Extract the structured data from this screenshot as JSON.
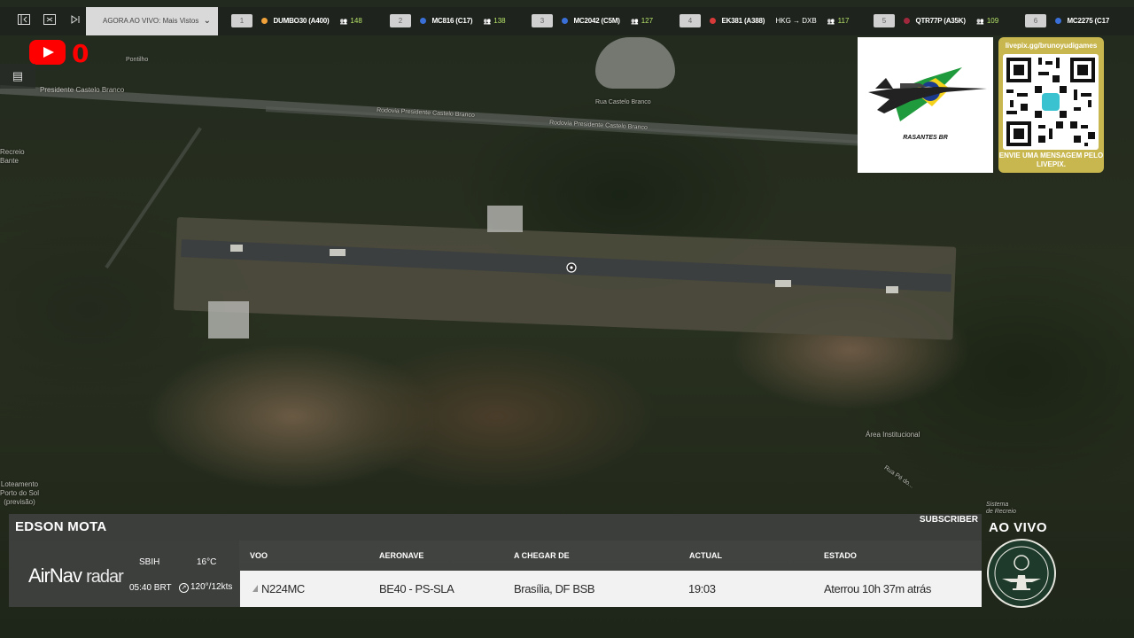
{
  "topbar": {
    "live_select": "AGORA AO VIVO: Mais Vistos",
    "flights": [
      {
        "num": "1",
        "callsign": "DUMBO30 (A400)",
        "count": "148",
        "dot": "#f2a23a"
      },
      {
        "num": "2",
        "callsign": "MC816 (C17)",
        "count": "138",
        "dot": "#3a6fd8"
      },
      {
        "num": "3",
        "callsign": "MC2042 (C5M)",
        "count": "127",
        "dot": "#3a6fd8"
      },
      {
        "num": "4",
        "callsign": "EK381 (A388)",
        "route": "HKG → DXB",
        "count": "117",
        "dot": "#d83a3a"
      },
      {
        "num": "5",
        "callsign": "QTR77P (A35K)",
        "count": "109",
        "dot": "#a0283c"
      },
      {
        "num": "6",
        "callsign": "MC2275 (C17",
        "count": "",
        "dot": "#3a6fd8"
      }
    ]
  },
  "youtube": {
    "count": "0"
  },
  "map": {
    "labels": {
      "road_top_left": "Presidente Castelo Branco",
      "road_mid": "Rodovia Presidente Castelo Branco",
      "road_mid2": "Rodovia Presidente Castelo Branco",
      "road_small": "Rua Castelo Branco",
      "pontilho": "Pontilho",
      "recreio": "Recreio\nBante",
      "loteamento": "Loteamento\nPorto do Sol\n(previsão)",
      "area_institucional": "Área Institucional",
      "rua_pe": "Rua Pé do...",
      "sistema": "Sistema\nde Recreio"
    }
  },
  "brand_card": {
    "text": "RASANTES BR"
  },
  "qr_card": {
    "url": "livepix.gg/brunoyudigames",
    "message": "ENVIE UMA MENSAGEM PELO LIVEPIX."
  },
  "panel": {
    "username": "EDSON MOTA",
    "subscriber": "SUBSCRIBER",
    "logo_main": "AirNav",
    "logo_sub": "radar",
    "airport": "SBIH",
    "time": "05:40 BRT",
    "temp": "16°C",
    "wind": "120°/12kts",
    "columns": {
      "voo": "VOO",
      "aeronave": "AERONAVE",
      "a_chegar_de": "A CHEGAR DE",
      "actual": "ACTUAL",
      "estado": "ESTADO"
    },
    "row": {
      "voo": "N224MC",
      "aeronave": "BE40 - PS-SLA",
      "a_chegar_de": "Brasília, DF BSB",
      "actual": "19:03",
      "estado": "Aterrou 10h 37m atrás"
    }
  },
  "badge": {
    "ao_vivo": "AO VIVO"
  },
  "colors": {
    "youtube_red": "#ff0000",
    "qr_gold": "#c8b74f",
    "viewer_green": "#b7e36a"
  }
}
